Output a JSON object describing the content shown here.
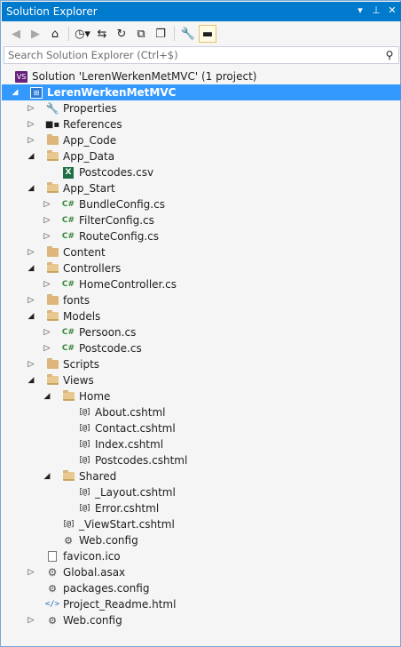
{
  "window": {
    "title": "Solution Explorer",
    "buttons": [
      "▾",
      "⊥",
      "✕"
    ]
  },
  "toolbar": {
    "items": [
      {
        "name": "back-icon",
        "glyph": "◀",
        "disabled": true
      },
      {
        "name": "forward-icon",
        "glyph": "▶",
        "disabled": true
      },
      {
        "name": "home-icon",
        "glyph": "⌂"
      },
      {
        "name": "history-icon",
        "glyph": "◷▾"
      },
      {
        "name": "sync-icon",
        "glyph": "⇆"
      },
      {
        "name": "refresh-icon",
        "glyph": "↻"
      },
      {
        "name": "collapse-all-icon",
        "glyph": "⧉"
      },
      {
        "name": "show-all-files-icon",
        "glyph": "❐"
      },
      {
        "name": "properties-icon",
        "glyph": "🔧"
      },
      {
        "name": "preview-icon",
        "glyph": "▬",
        "active": true
      }
    ]
  },
  "search": {
    "placeholder": "Search Solution Explorer (Ctrl+$)"
  },
  "tree": [
    {
      "label": "Solution 'LerenWerkenMetMVC' (1 project)",
      "level": 0,
      "icon": "solution",
      "arrow": ""
    },
    {
      "label": "LerenWerkenMetMVC",
      "level": 1,
      "icon": "web-project",
      "arrow": "open",
      "selected": true
    },
    {
      "label": "Properties",
      "level": 2,
      "icon": "wrench",
      "arrow": "closed"
    },
    {
      "label": "References",
      "level": 2,
      "icon": "references",
      "arrow": "closed"
    },
    {
      "label": "App_Code",
      "level": 2,
      "icon": "folder",
      "arrow": "closed"
    },
    {
      "label": "App_Data",
      "level": 2,
      "icon": "folder-open",
      "arrow": "open"
    },
    {
      "label": "Postcodes.csv",
      "level": 3,
      "icon": "excel",
      "arrow": ""
    },
    {
      "label": "App_Start",
      "level": 2,
      "icon": "folder-open",
      "arrow": "open"
    },
    {
      "label": "BundleConfig.cs",
      "level": 3,
      "icon": "csharp",
      "arrow": "closed"
    },
    {
      "label": "FilterConfig.cs",
      "level": 3,
      "icon": "csharp",
      "arrow": "closed"
    },
    {
      "label": "RouteConfig.cs",
      "level": 3,
      "icon": "csharp",
      "arrow": "closed"
    },
    {
      "label": "Content",
      "level": 2,
      "icon": "folder",
      "arrow": "closed"
    },
    {
      "label": "Controllers",
      "level": 2,
      "icon": "folder-open",
      "arrow": "open"
    },
    {
      "label": "HomeController.cs",
      "level": 3,
      "icon": "csharp",
      "arrow": "closed"
    },
    {
      "label": "fonts",
      "level": 2,
      "icon": "folder",
      "arrow": "closed"
    },
    {
      "label": "Models",
      "level": 2,
      "icon": "folder-open",
      "arrow": "open"
    },
    {
      "label": "Persoon.cs",
      "level": 3,
      "icon": "csharp",
      "arrow": "closed"
    },
    {
      "label": "Postcode.cs",
      "level": 3,
      "icon": "csharp",
      "arrow": "closed"
    },
    {
      "label": "Scripts",
      "level": 2,
      "icon": "folder",
      "arrow": "closed"
    },
    {
      "label": "Views",
      "level": 2,
      "icon": "folder-open",
      "arrow": "open"
    },
    {
      "label": "Home",
      "level": 3,
      "icon": "folder-open",
      "arrow": "open"
    },
    {
      "label": "About.cshtml",
      "level": 4,
      "icon": "cshtml",
      "arrow": ""
    },
    {
      "label": "Contact.cshtml",
      "level": 4,
      "icon": "cshtml",
      "arrow": ""
    },
    {
      "label": "Index.cshtml",
      "level": 4,
      "icon": "cshtml",
      "arrow": ""
    },
    {
      "label": "Postcodes.cshtml",
      "level": 4,
      "icon": "cshtml",
      "arrow": ""
    },
    {
      "label": "Shared",
      "level": 3,
      "icon": "folder-open",
      "arrow": "open"
    },
    {
      "label": "_Layout.cshtml",
      "level": 4,
      "icon": "cshtml",
      "arrow": ""
    },
    {
      "label": "Error.cshtml",
      "level": 4,
      "icon": "cshtml",
      "arrow": ""
    },
    {
      "label": "_ViewStart.cshtml",
      "level": 3,
      "icon": "cshtml",
      "arrow": ""
    },
    {
      "label": "Web.config",
      "level": 3,
      "icon": "config",
      "arrow": ""
    },
    {
      "label": "favicon.ico",
      "level": 2,
      "icon": "ico",
      "arrow": ""
    },
    {
      "label": "Global.asax",
      "level": 2,
      "icon": "gear",
      "arrow": "closed"
    },
    {
      "label": "packages.config",
      "level": 2,
      "icon": "config",
      "arrow": ""
    },
    {
      "label": "Project_Readme.html",
      "level": 2,
      "icon": "html",
      "arrow": ""
    },
    {
      "label": "Web.config",
      "level": 2,
      "icon": "config",
      "arrow": "closed"
    }
  ]
}
